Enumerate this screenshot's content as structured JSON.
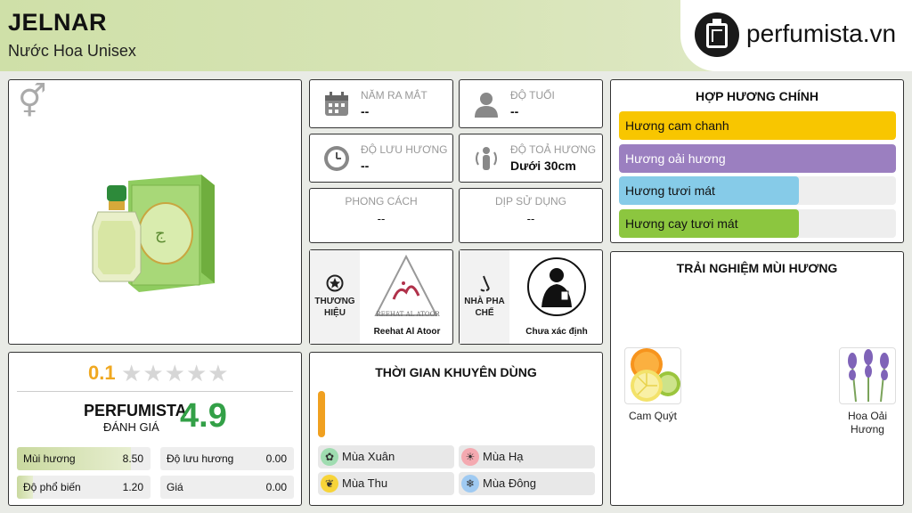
{
  "header": {
    "title": "JELNAR",
    "subtitle": "Nước Hoa Unisex",
    "logo_text": "perfumista.vn"
  },
  "info": {
    "release_year": {
      "label": "NĂM RA MẮT",
      "value": "--"
    },
    "age": {
      "label": "ĐỘ TUỔI",
      "value": "--"
    },
    "longevity": {
      "label": "ĐỘ LƯU HƯƠNG",
      "value": "--"
    },
    "sillage": {
      "label": "ĐỘ TOẢ HƯƠNG",
      "value": "Dưới 30cm"
    },
    "style": {
      "label": "PHONG CÁCH",
      "value": "--"
    },
    "occasion": {
      "label": "DỊP SỬ DỤNG",
      "value": "--"
    },
    "brand": {
      "label": "THƯƠNG HIỆU",
      "name": "Reehat Al Atoor",
      "logo_text": "REEHAT AL ATOOR"
    },
    "perfumer": {
      "label": "NHÀ PHA CHẾ",
      "name": "Chưa xác định"
    }
  },
  "accords": {
    "title": "HỢP HƯƠNG CHÍNH",
    "items": [
      {
        "label": "Hương cam chanh",
        "level": 100,
        "color": "#f8c600"
      },
      {
        "label": "Hương oải hương",
        "level": 100,
        "color": "#9b7fc0"
      },
      {
        "label": "Hương tươi mát",
        "level": 65,
        "color": "#86cbe8"
      },
      {
        "label": "Hương cay tươi mát",
        "level": 65,
        "color": "#8cc63f"
      }
    ]
  },
  "rating": {
    "score": "0.1",
    "stars_filled": 0,
    "stars_total": 5,
    "brand_label": "PERFUMISTA",
    "review_label": "ĐÁNH GIÁ",
    "perfumista_score": "4.9",
    "stats": [
      {
        "label": "Mùi hương",
        "value": "8.50",
        "level": 0.85
      },
      {
        "label": "Độ lưu hương",
        "value": "0.00",
        "level": 0
      },
      {
        "label": "Độ phổ biến",
        "value": "1.20",
        "level": 0.12
      },
      {
        "label": "Giá",
        "value": "0.00",
        "level": 0
      }
    ]
  },
  "seasons": {
    "title": "THỜI GIAN KHUYÊN DÙNG",
    "items": [
      {
        "label": "Mùa Xuân",
        "color": "#9fdcb0"
      },
      {
        "label": "Mùa Hạ",
        "color": "#f4a9b0"
      },
      {
        "label": "Mùa Thu",
        "color": "#f7d439"
      },
      {
        "label": "Mùa Đông",
        "color": "#9fcaf2"
      }
    ],
    "time_color": "#f0a020"
  },
  "notes": {
    "title": "TRẢI NGHIỆM MÙI HƯƠNG",
    "items": [
      {
        "label": "Cam Quýt"
      },
      {
        "label": "Hoa Oải Hương"
      }
    ]
  }
}
